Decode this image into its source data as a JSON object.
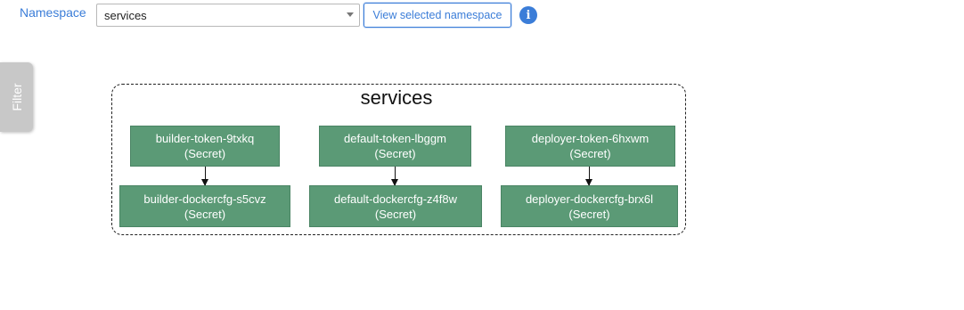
{
  "toolbar": {
    "namespace_label": "Namespace",
    "namespace_value": "services",
    "view_button": "View selected namespace",
    "info_glyph": "i"
  },
  "filter_tab": {
    "label": "Filter"
  },
  "graph": {
    "group_title": "services",
    "node_color": "#5b9a76",
    "nodes": [
      {
        "name": "builder-token-9txkq",
        "kind": "(Secret)"
      },
      {
        "name": "default-token-lbggm",
        "kind": "(Secret)"
      },
      {
        "name": "deployer-token-6hxwm",
        "kind": "(Secret)"
      },
      {
        "name": "builder-dockercfg-s5cvz",
        "kind": "(Secret)"
      },
      {
        "name": "default-dockercfg-z4f8w",
        "kind": "(Secret)"
      },
      {
        "name": "deployer-dockercfg-brx6l",
        "kind": "(Secret)"
      }
    ],
    "edges": [
      {
        "from": "builder-token-9txkq",
        "to": "builder-dockercfg-s5cvz"
      },
      {
        "from": "default-token-lbggm",
        "to": "default-dockercfg-z4f8w"
      },
      {
        "from": "deployer-token-6hxwm",
        "to": "deployer-dockercfg-brx6l"
      }
    ]
  }
}
